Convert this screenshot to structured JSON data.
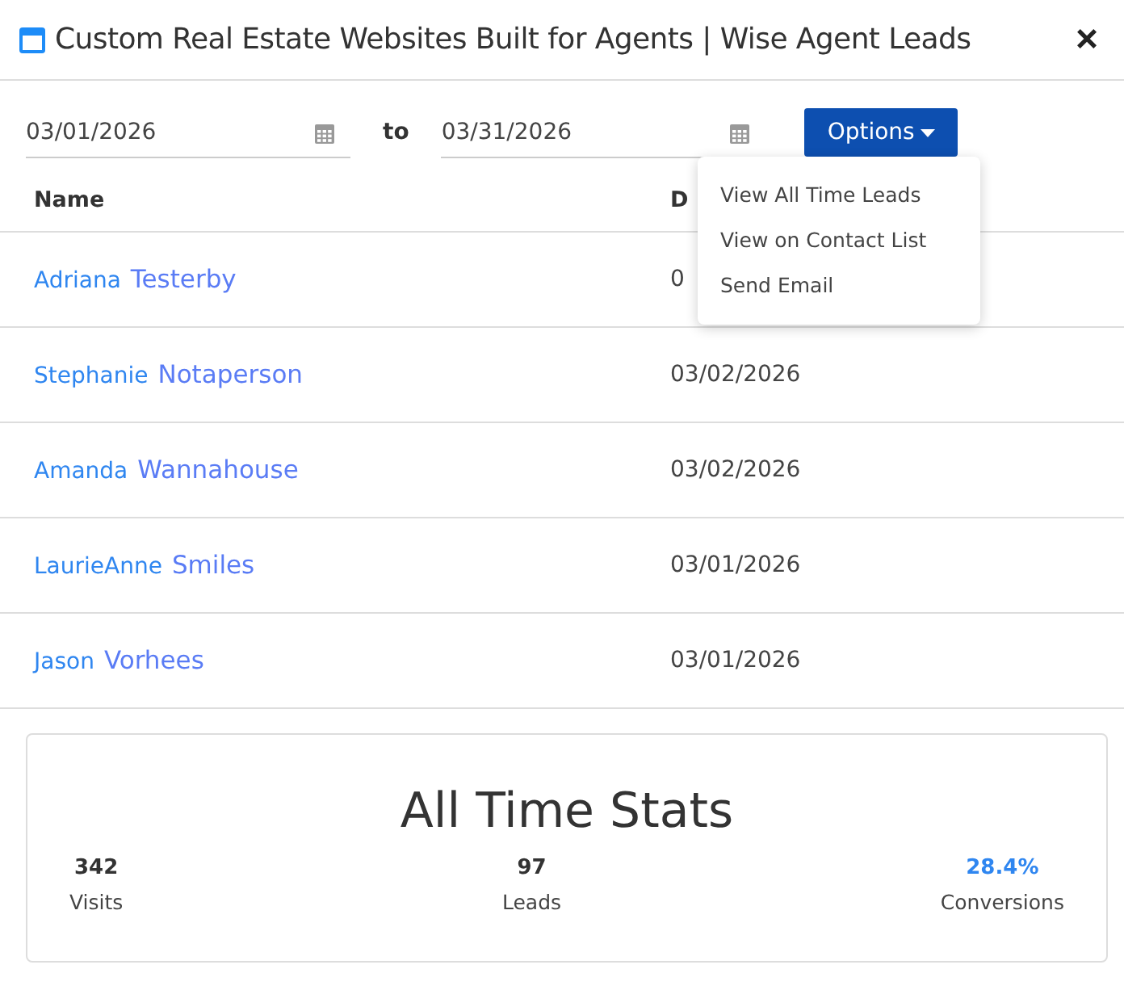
{
  "window": {
    "title": "Custom Real Estate Websites Built for Agents | Wise Agent Leads",
    "close": "×"
  },
  "filters": {
    "start_date": "03/01/2026",
    "separator": "to",
    "end_date": "03/31/2026",
    "options_button": "Options"
  },
  "options_menu": {
    "items": [
      "View All Time Leads",
      "View on Contact List",
      "Send Email"
    ]
  },
  "table": {
    "columns": [
      "Name",
      "D"
    ],
    "rows": [
      {
        "first_name": "Adriana",
        "last_name": "Testerby",
        "date": "0"
      },
      {
        "first_name": "Stephanie",
        "last_name": "Notaperson",
        "date": "03/02/2026"
      },
      {
        "first_name": "Amanda",
        "last_name": "Wannahouse",
        "date": "03/02/2026"
      },
      {
        "first_name": "LaurieAnne",
        "last_name": "Smiles",
        "date": "03/01/2026"
      },
      {
        "first_name": "Jason",
        "last_name": "Vorhees",
        "date": "03/01/2026"
      }
    ]
  },
  "stats": {
    "title": "All Time Stats",
    "items": [
      {
        "value": "342",
        "label": "Visits",
        "kind": "plain"
      },
      {
        "value": "97",
        "label": "Leads",
        "kind": "plain"
      },
      {
        "value": "28.4%",
        "label": "Conversions",
        "kind": "highlight"
      }
    ]
  }
}
